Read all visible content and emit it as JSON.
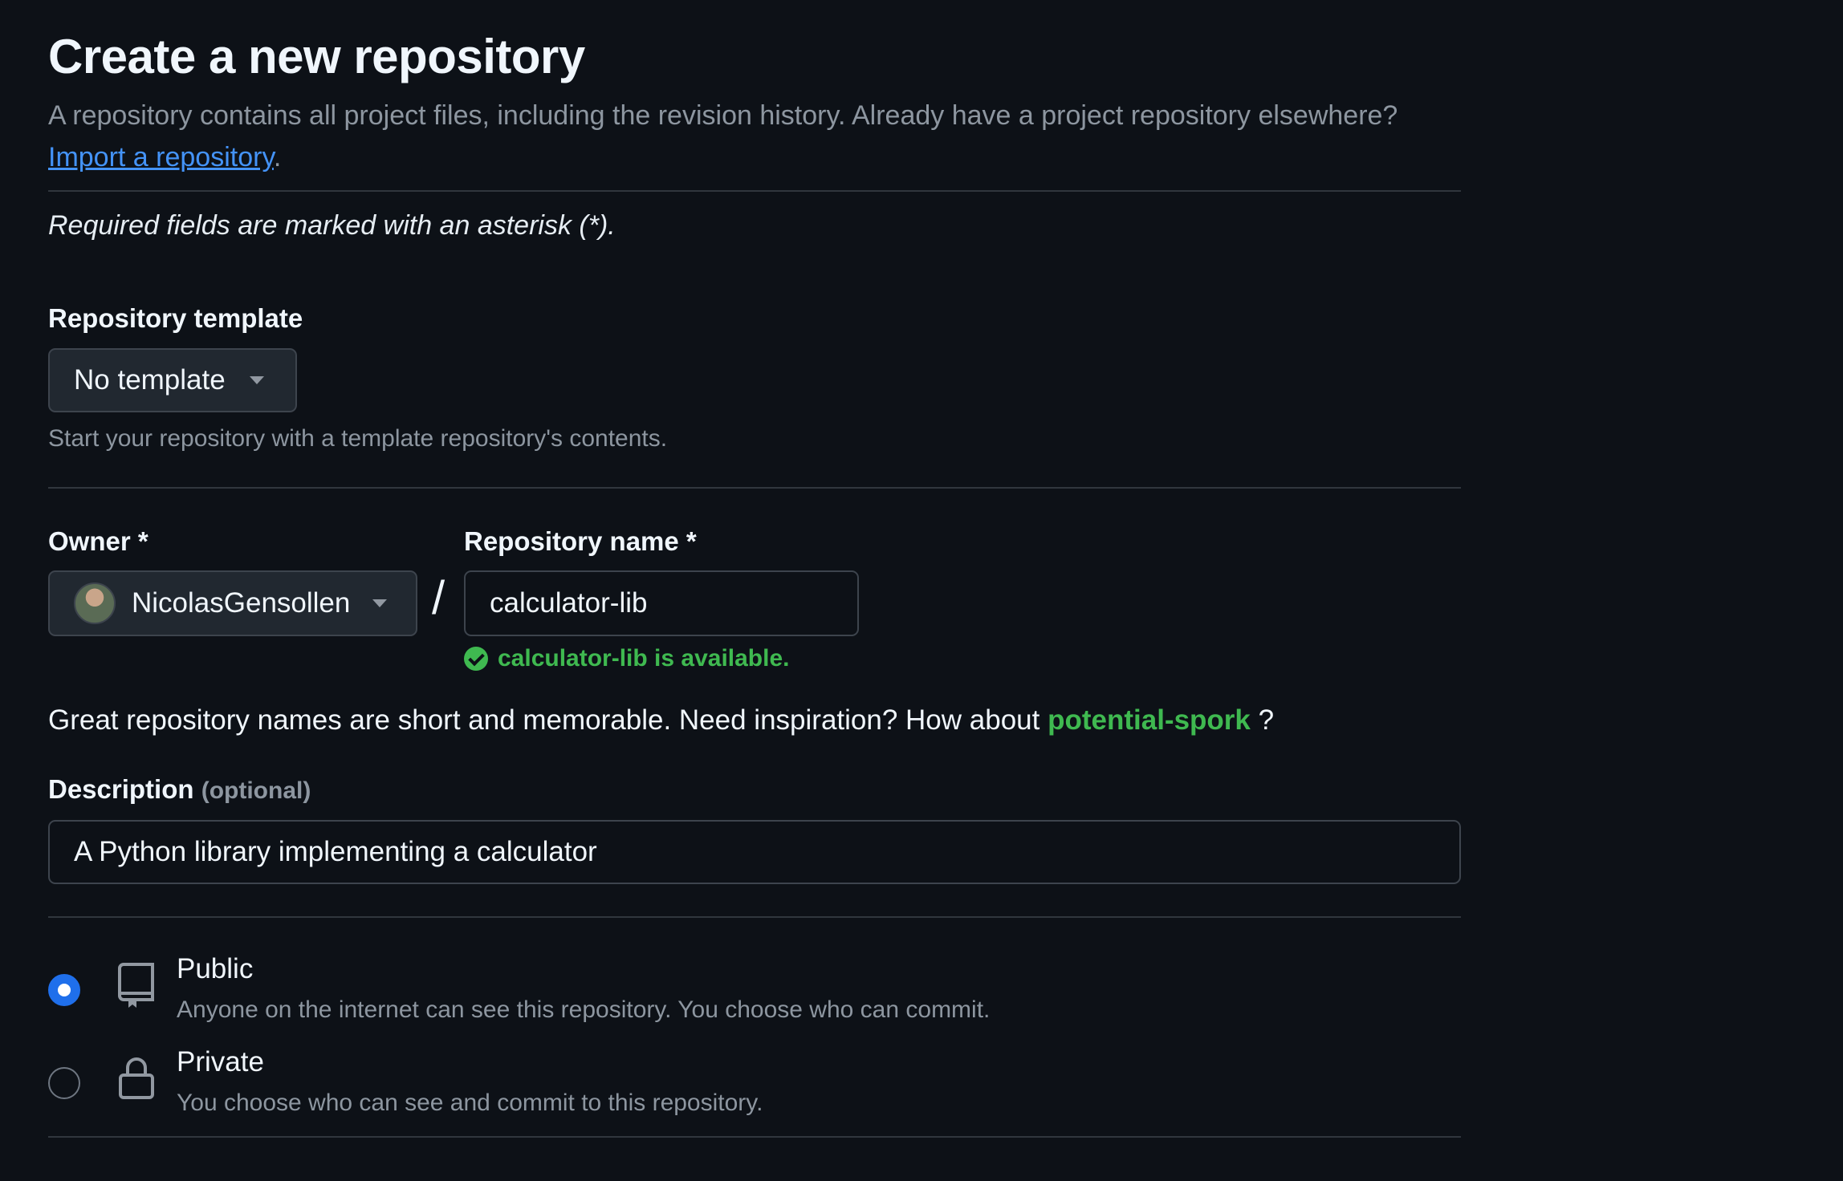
{
  "page": {
    "title": "Create a new repository",
    "subtitle": "A repository contains all project files, including the revision history. Already have a project repository elsewhere?",
    "import_link": "Import a repository",
    "import_suffix": ".",
    "required_note": "Required fields are marked with an asterisk (*)."
  },
  "template": {
    "label": "Repository template",
    "selected": "No template",
    "hint": "Start your repository with a template repository's contents."
  },
  "owner": {
    "label": "Owner *",
    "selected": "NicolasGensollen"
  },
  "separator": "/",
  "repo_name": {
    "label": "Repository name *",
    "value": "calculator-lib",
    "availability": "calculator-lib is available."
  },
  "inspiration": {
    "text": "Great repository names are short and memorable. Need inspiration? How about",
    "suggestion": "potential-spork",
    "suffix": "?"
  },
  "description": {
    "label": "Description",
    "optional": "(optional)",
    "value": "A Python library implementing a calculator"
  },
  "visibility": {
    "options": [
      {
        "label": "Public",
        "description": "Anyone on the internet can see this repository. You choose who can commit.",
        "selected": true,
        "icon": "repo-icon"
      },
      {
        "label": "Private",
        "description": "You choose who can see and commit to this repository.",
        "selected": false,
        "icon": "lock-icon"
      }
    ]
  },
  "colors": {
    "background": "#0d1117",
    "link": "#4493f8",
    "success": "#3fb950",
    "radio_selected": "#1f6feb"
  }
}
